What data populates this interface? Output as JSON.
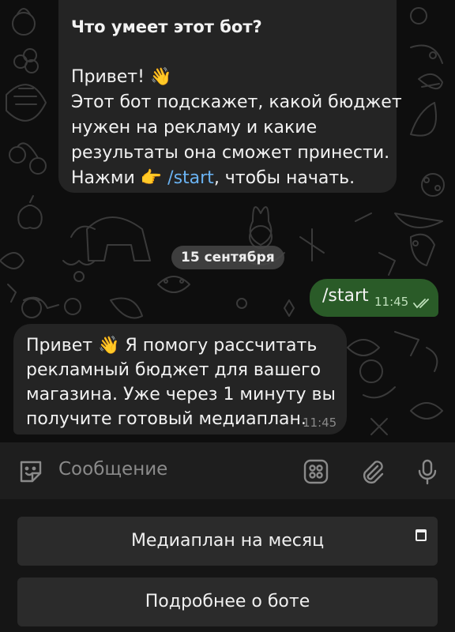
{
  "intro": {
    "title": "Что умеет этот бот?",
    "greeting": "Привет!",
    "greeting_emoji": "👋",
    "line1": "Этот бот подскажет, какой бюджет",
    "line2": "нужен на рекламу и какие",
    "line3": "результаты она сможет принести.",
    "line4_pre": "Нажми",
    "line4_emoji": "👉",
    "command": "/start",
    "line4_post": ", чтобы начать."
  },
  "date_separator": "15 сентября",
  "outgoing": {
    "text": "/start",
    "time": "11:45",
    "status_icon": "double-check-icon"
  },
  "incoming": {
    "line1_pre": "Привет",
    "emoji": "👋",
    "line1_post": "Я помогу рассчитать",
    "line2": "рекламный бюджет для вашего",
    "line3": "магазина. Уже через 1 минуту вы",
    "line4": "получите готовый медиаплан.",
    "time": "11:45"
  },
  "composer": {
    "placeholder": "Сообщение",
    "icons": [
      "sticker-icon",
      "bot-keyboard-icon",
      "attach-icon",
      "microphone-icon"
    ]
  },
  "keyboard": {
    "buttons": [
      {
        "label": "Медиаплан на месяц"
      },
      {
        "label": "Подробнее о боте"
      }
    ]
  },
  "colors": {
    "background": "#0e0e0e",
    "bubble_in": "#242424",
    "bubble_out": "#2a5b28",
    "link": "#6ab3f3",
    "keyboard_button": "#2b2b2b"
  }
}
